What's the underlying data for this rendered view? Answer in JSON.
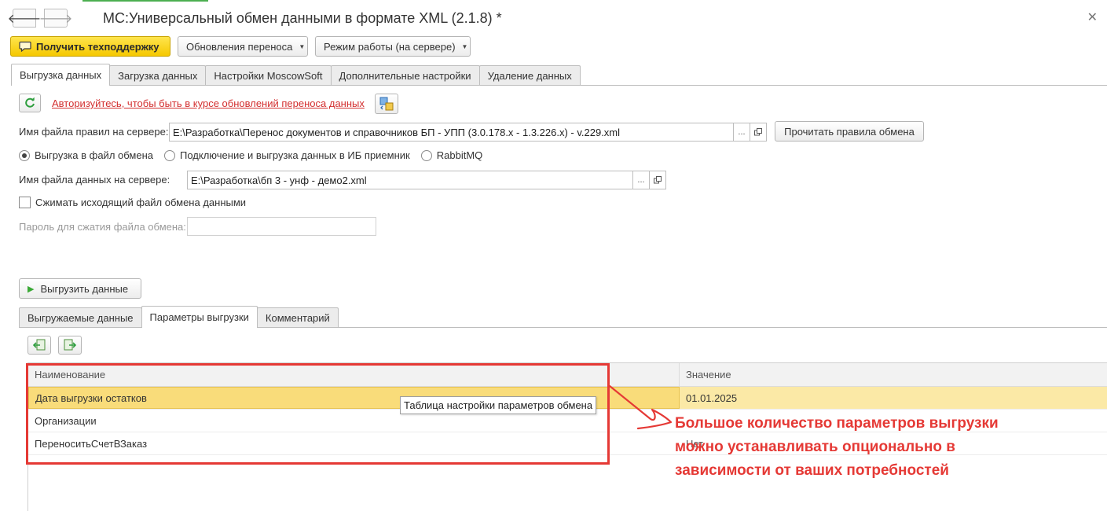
{
  "window": {
    "title": "МС:Универсальный обмен данными в формате XML (2.1.8) *",
    "back_glyph": "🡐",
    "forward_glyph": "🡒",
    "close_glyph": "✕"
  },
  "toolbar": {
    "support_label": "Получить техподдержку",
    "updates_label": "Обновления переноса",
    "mode_label": "Режим работы (на сервере)",
    "caret_glyph": "▼"
  },
  "main_tabs": [
    {
      "label": "Выгрузка данных",
      "active": true
    },
    {
      "label": "Загрузка данных",
      "active": false
    },
    {
      "label": "Настройки MoscowSoft",
      "active": false
    },
    {
      "label": "Дополнительные настройки",
      "active": false
    },
    {
      "label": "Удаление данных",
      "active": false
    }
  ],
  "auth": {
    "link_text": "Авторизуйтесь, чтобы быть в курсе обновлений переноса данных"
  },
  "rules_file": {
    "label": "Имя файла правил на сервере:",
    "value": "E:\\Разработка\\Перенос документов и справочников БП - УПП (3.0.178.x - 1.3.226.x) - v.229.xml",
    "dots": "...",
    "read_button": "Прочитать правила обмена"
  },
  "export_mode": {
    "options": [
      {
        "label": "Выгрузка в файл обмена",
        "selected": true
      },
      {
        "label": "Подключение и выгрузка данных в ИБ приемник",
        "selected": false
      },
      {
        "label": "RabbitMQ",
        "selected": false
      }
    ]
  },
  "data_file": {
    "label": "Имя файла данных на сервере:",
    "value": "E:\\Разработка\\бп 3 - унф - демо2.xml",
    "dots": "..."
  },
  "compress": {
    "label": "Сжимать исходящий файл обмена данными",
    "checked": false
  },
  "password": {
    "label": "Пароль для сжатия файла обмена:",
    "value": ""
  },
  "export_button": {
    "label": "Выгрузить данные",
    "play_glyph": "▶"
  },
  "sub_tabs": [
    {
      "label": "Выгружаемые данные",
      "active": false
    },
    {
      "label": "Параметры выгрузки",
      "active": true
    },
    {
      "label": "Комментарий",
      "active": false
    }
  ],
  "params_table": {
    "columns": [
      "Наименование",
      "Значение"
    ],
    "rows": [
      {
        "name": "Дата выгрузки остатков",
        "value": "01.01.2025",
        "selected": true
      },
      {
        "name": "Организации",
        "value": "",
        "selected": false
      },
      {
        "name": "ПереноситьСчетВЗаказ",
        "value": "Нет",
        "selected": false
      }
    ]
  },
  "tooltip": "Таблица настройки параметров обмена",
  "annotation": {
    "lines": [
      "Большое количество параметров выгрузки",
      "можно устанавливать опционально в",
      "зависимости от ваших потребностей"
    ]
  },
  "colors": {
    "yellow_button": "#f5c800",
    "link_red": "#d32f2f",
    "annotation_red": "#e53935",
    "selected_row": "#fbe9a6",
    "refresh_green": "#2e9e3e",
    "play_green": "#3aa935"
  }
}
